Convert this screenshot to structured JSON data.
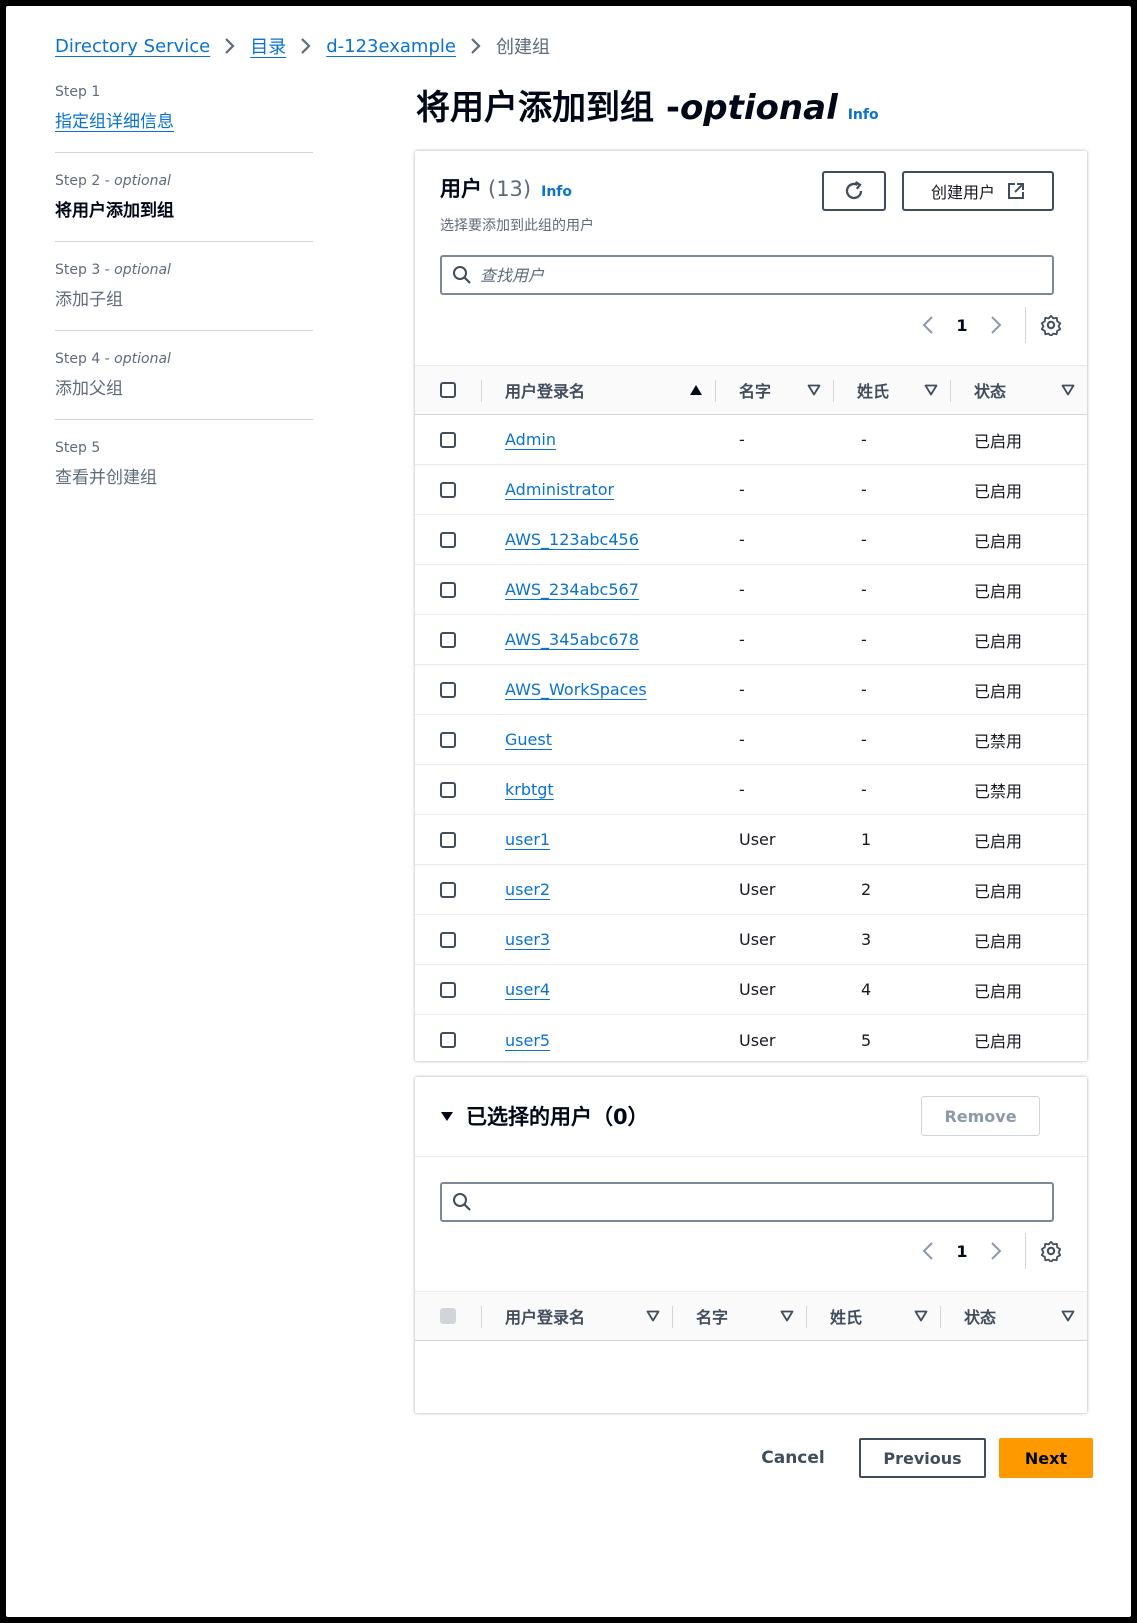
{
  "breadcrumb": {
    "items": [
      "Directory Service",
      "目录",
      "d-123example"
    ],
    "current": "创建组"
  },
  "steps": [
    {
      "label": "Step 1",
      "optional": "",
      "title": "指定组详细信息"
    },
    {
      "label": "Step 2",
      "optional": " - optional",
      "title": "将用户添加到组"
    },
    {
      "label": "Step 3",
      "optional": " - optional",
      "title": "添加子组"
    },
    {
      "label": "Step 4",
      "optional": " - optional",
      "title": "添加父组"
    },
    {
      "label": "Step 5",
      "optional": "",
      "title": "查看并创建组"
    }
  ],
  "page": {
    "title": "将用户添加到组 - ",
    "title_optional": "optional",
    "info": "Info"
  },
  "users_panel": {
    "title": "用户",
    "count": "(13)",
    "info": "Info",
    "description": "选择要添加到此组的用户",
    "create_user_label": "创建用户",
    "search_placeholder": "查找用户",
    "page_number": "1",
    "columns": [
      "用户登录名",
      "名字",
      "姓氏",
      "状态"
    ],
    "rows": [
      {
        "login": "Admin",
        "first": "-",
        "last": "-",
        "status": "已启用"
      },
      {
        "login": "Administrator",
        "first": "-",
        "last": "-",
        "status": "已启用"
      },
      {
        "login": "AWS_123abc456",
        "first": "-",
        "last": "-",
        "status": "已启用"
      },
      {
        "login": "AWS_234abc567",
        "first": "-",
        "last": "-",
        "status": "已启用"
      },
      {
        "login": "AWS_345abc678",
        "first": "-",
        "last": "-",
        "status": "已启用"
      },
      {
        "login": "AWS_WorkSpaces",
        "first": "-",
        "last": "-",
        "status": "已启用"
      },
      {
        "login": "Guest",
        "first": "-",
        "last": "-",
        "status": "已禁用"
      },
      {
        "login": "krbtgt",
        "first": "-",
        "last": "-",
        "status": "已禁用"
      },
      {
        "login": "user1",
        "first": "User",
        "last": "1",
        "status": "已启用"
      },
      {
        "login": "user2",
        "first": "User",
        "last": "2",
        "status": "已启用"
      },
      {
        "login": "user3",
        "first": "User",
        "last": "3",
        "status": "已启用"
      },
      {
        "login": "user4",
        "first": "User",
        "last": "4",
        "status": "已启用"
      },
      {
        "login": "user5",
        "first": "User",
        "last": "5",
        "status": "已启用"
      }
    ]
  },
  "selected_panel": {
    "title": "已选择的用户（0）",
    "remove_label": "Remove",
    "search_placeholder": "",
    "page_number": "1",
    "columns": [
      "用户登录名",
      "名字",
      "姓氏",
      "状态"
    ]
  },
  "footer": {
    "cancel": "Cancel",
    "previous": "Previous",
    "next": "Next"
  },
  "colors": {
    "link": "#0972d3",
    "primary_button": "#ff9900",
    "text": "#16191f",
    "secondary_text": "#5f6b7a"
  },
  "icons": [
    "chevron-right-icon",
    "refresh-icon",
    "external-link-icon",
    "search-icon",
    "chevron-left-icon",
    "gear-icon",
    "sort-ascending-icon",
    "sort-descending-icon",
    "caret-down-icon"
  ]
}
